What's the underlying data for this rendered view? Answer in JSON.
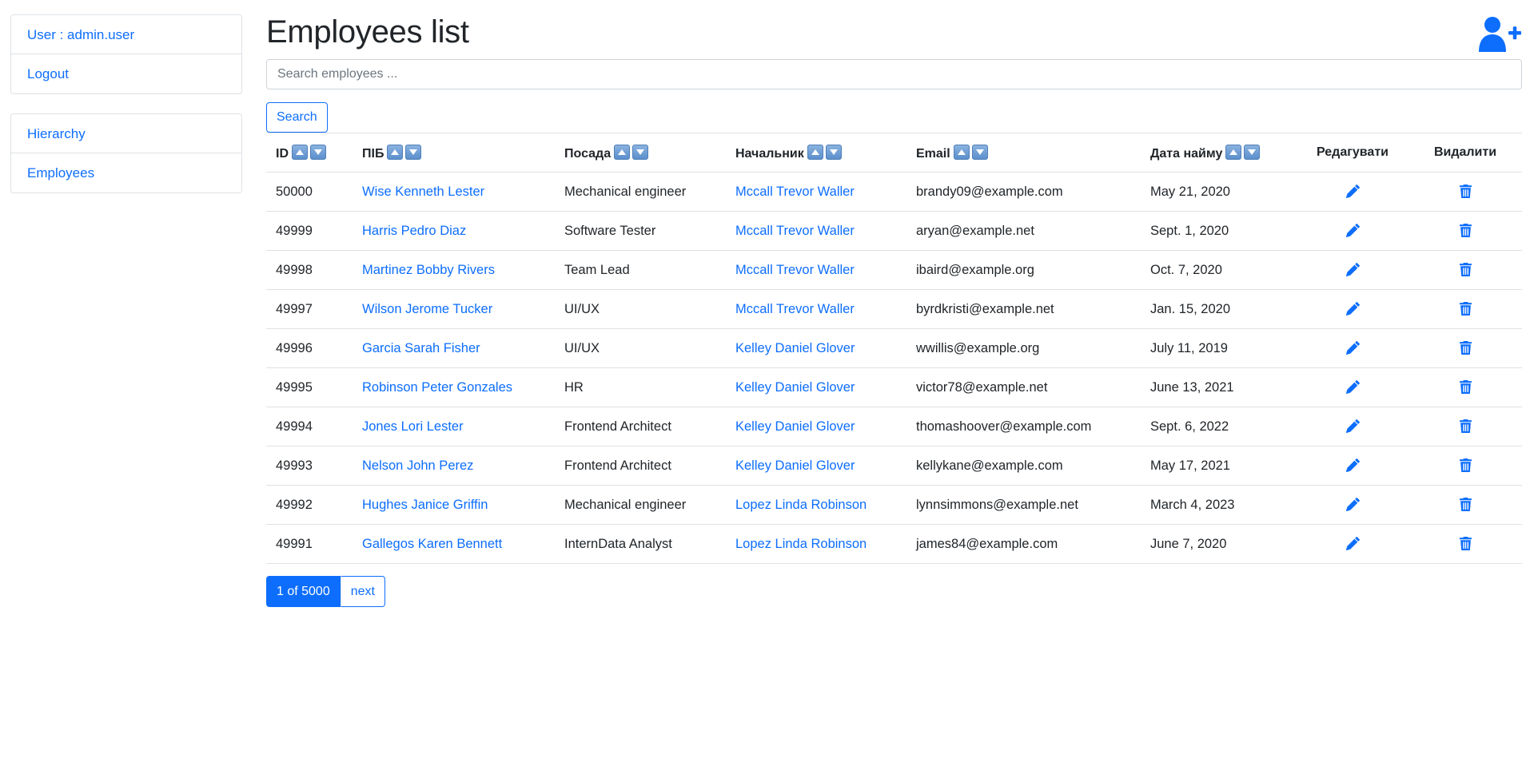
{
  "sidebar": {
    "account": [
      {
        "label": "User : admin.user"
      },
      {
        "label": "Logout"
      }
    ],
    "nav": [
      {
        "label": "Hierarchy"
      },
      {
        "label": "Employees"
      }
    ]
  },
  "header": {
    "title": "Employees list",
    "add_icon": "user-plus-icon"
  },
  "search": {
    "placeholder": "Search employees ...",
    "value": "",
    "button_label": "Search"
  },
  "table": {
    "columns": [
      "ID",
      "ПІБ",
      "Посада",
      "Начальник",
      "Email",
      "Дата найму",
      "Редагувати",
      "Видалити"
    ],
    "sort_icons": [
      "sort-up-icon",
      "sort-down-icon"
    ],
    "rows": [
      {
        "id": "50000",
        "name": "Wise Kenneth Lester",
        "position": "Mechanical engineer",
        "manager": "Mccall Trevor Waller",
        "email": "brandy09@example.com",
        "hired": "May 21, 2020"
      },
      {
        "id": "49999",
        "name": "Harris Pedro Diaz",
        "position": "Software Tester",
        "manager": "Mccall Trevor Waller",
        "email": "aryan@example.net",
        "hired": "Sept. 1, 2020"
      },
      {
        "id": "49998",
        "name": "Martinez Bobby Rivers",
        "position": "Team Lead",
        "manager": "Mccall Trevor Waller",
        "email": "ibaird@example.org",
        "hired": "Oct. 7, 2020"
      },
      {
        "id": "49997",
        "name": "Wilson Jerome Tucker",
        "position": "UI/UX",
        "manager": "Mccall Trevor Waller",
        "email": "byrdkristi@example.net",
        "hired": "Jan. 15, 2020"
      },
      {
        "id": "49996",
        "name": "Garcia Sarah Fisher",
        "position": "UI/UX",
        "manager": "Kelley Daniel Glover",
        "email": "wwillis@example.org",
        "hired": "July 11, 2019"
      },
      {
        "id": "49995",
        "name": "Robinson Peter Gonzales",
        "position": "HR",
        "manager": "Kelley Daniel Glover",
        "email": "victor78@example.net",
        "hired": "June 13, 2021"
      },
      {
        "id": "49994",
        "name": "Jones Lori Lester",
        "position": "Frontend Architect",
        "manager": "Kelley Daniel Glover",
        "email": "thomashoover@example.com",
        "hired": "Sept. 6, 2022"
      },
      {
        "id": "49993",
        "name": "Nelson John Perez",
        "position": "Frontend Architect",
        "manager": "Kelley Daniel Glover",
        "email": "kellykane@example.com",
        "hired": "May 17, 2021"
      },
      {
        "id": "49992",
        "name": "Hughes Janice Griffin",
        "position": "Mechanical engineer",
        "manager": "Lopez Linda Robinson",
        "email": "lynnsimmons@example.net",
        "hired": "March 4, 2023"
      },
      {
        "id": "49991",
        "name": "Gallegos Karen Bennett",
        "position": "InternData Analyst",
        "manager": "Lopez Linda Robinson",
        "email": "james84@example.com",
        "hired": "June 7, 2020"
      }
    ],
    "edit_icon": "pencil-icon",
    "delete_icon": "trash-icon"
  },
  "pagination": {
    "current": "1 of 5000",
    "next_label": "next"
  },
  "colors": {
    "accent": "#0d6efd",
    "text": "#212529",
    "border": "#dee2e6"
  }
}
